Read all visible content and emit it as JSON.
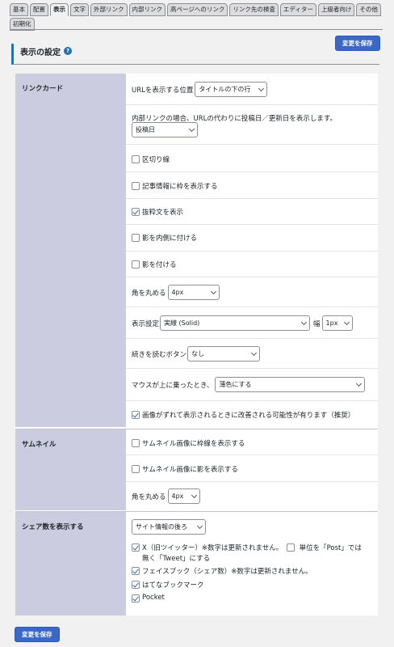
{
  "tabs": [
    "基本",
    "配置",
    "表示",
    "文字",
    "外部リンク",
    "内部リンク",
    "高ページへのリンク",
    "リンク先の検査",
    "エディター",
    "上級者向け",
    "その他",
    "初期化"
  ],
  "active_tab": "表示",
  "save_label": "変更を保存",
  "heading": "表示の設定",
  "help_icon": "?",
  "linkcard": {
    "label": "リンクカード",
    "url_position_label": "URLを表示する位置",
    "url_position_value": "タイトルの下の行",
    "internal_label": "内部リンクの場合、URLの代わりに投稿日／更新日を表示します。",
    "internal_value": "投稿日",
    "separator": "区切り線",
    "border_article": "記事情報に枠を表示する",
    "show_excerpt": "抜粋文を表示",
    "inner_shadow": "影を内側に付ける",
    "shadow": "影を付ける",
    "radius_label": "角を丸める",
    "radius_value": "4px",
    "display_setting_label": "表示設定",
    "display_setting_value": "実線 (Solid)",
    "width_label": "幅",
    "width_value": "1px",
    "readmore_label": "続きを読むボタン",
    "readmore_value": "なし",
    "hover_label": "マウスが上に乗ったとき、",
    "hover_value": "薄色にする",
    "image_fix": "画像がずれて表示されるときに改善される可能性が有ります（推奨）"
  },
  "thumbnail": {
    "label": "サムネイル",
    "border": "サムネイル画像に枠線を表示する",
    "shadow": "サムネイル画像に影を表示する",
    "radius_label": "角を丸める",
    "radius_value": "4px"
  },
  "share": {
    "label": "シェア数を表示する",
    "position_value": "サイト情報の後ろ",
    "x_label": "X（旧ツイッター）※数字は更新されません。",
    "unit_label_1": "単位を「Post」では",
    "unit_label_2": "無く「Tweet」にする",
    "facebook": "フェイスブック（シェア数）※数字は更新されません。",
    "hatena": "はてなブックマーク",
    "pocket": "Pocket"
  }
}
